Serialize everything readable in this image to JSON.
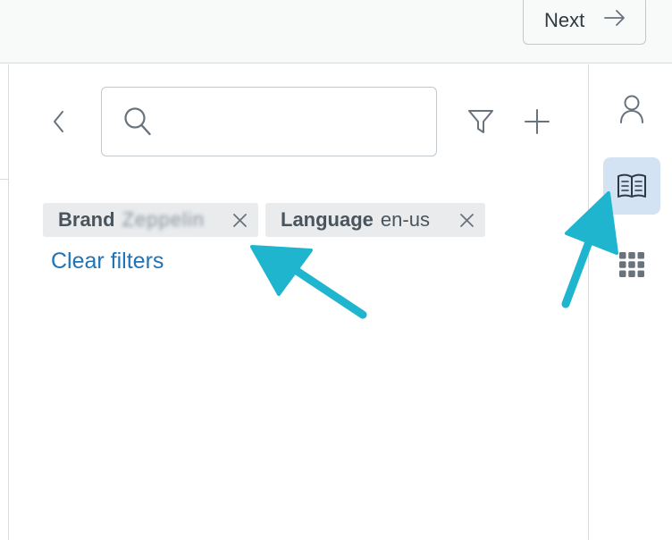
{
  "topbar": {
    "next_label": "Next"
  },
  "panel": {
    "search": {
      "placeholder": "",
      "value": ""
    },
    "filters": [
      {
        "key": "Brand",
        "value": "Zeppelin"
      },
      {
        "key": "Language",
        "value": "en-us"
      }
    ],
    "clear_filters": "Clear filters"
  },
  "rail": {
    "active": "knowledge"
  },
  "colors": {
    "link": "#1f73b7",
    "chip_bg": "#e9ebed",
    "rail_active_bg": "#d4e3f3",
    "annotation_arrow": "#1fb5cf"
  }
}
